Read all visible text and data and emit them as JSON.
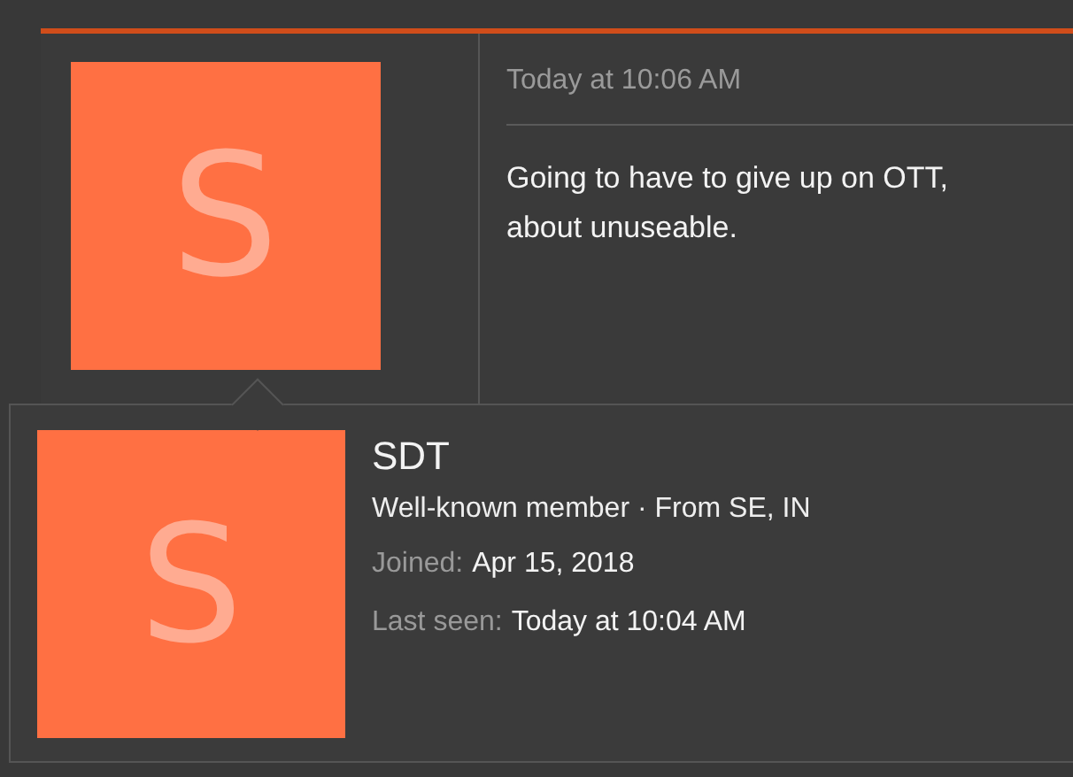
{
  "post": {
    "avatar_letter": "S",
    "timestamp": "Today at 10:06 AM",
    "lines": [
      "Going to have to give up on OTT,",
      "about unuseable."
    ]
  },
  "member_tooltip": {
    "avatar_letter": "S",
    "name": "SDT",
    "info": "Well-known member · From SE, IN",
    "facts": [
      {
        "label": "Joined:",
        "value": "Apr 15, 2018"
      },
      {
        "label": "Last seen:",
        "value": "Today at 10:04 AM"
      }
    ]
  }
}
